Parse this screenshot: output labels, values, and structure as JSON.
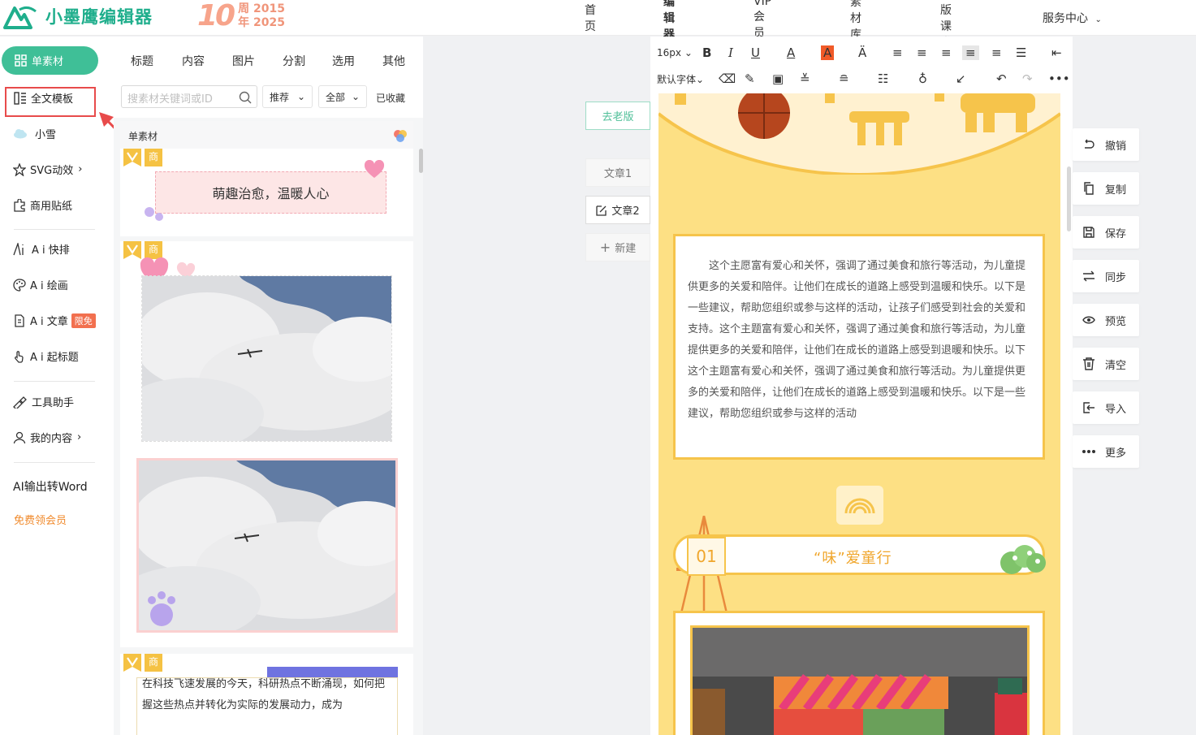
{
  "header": {
    "logo_text": "小墨鹰编辑器",
    "anniversary": {
      "number": "10",
      "line1": "周 2015",
      "line2": "年 2025"
    },
    "nav": [
      "首页",
      "编辑器",
      "VIP会员",
      "素材库",
      "排版课堂",
      "服务中心"
    ]
  },
  "sidebar": {
    "active": "单素材",
    "items": [
      "全文模板",
      "小雪",
      "SVG动效",
      "商用贴纸",
      "A i 快排",
      "A i 绘画",
      "A i 文章",
      "A i 起标题",
      "工具助手",
      "我的内容",
      "AI输出转Word"
    ],
    "badge_limited": "限免",
    "free_vip": "免费领会员"
  },
  "panel": {
    "tabs": [
      "标题",
      "内容",
      "图片",
      "分割",
      "选用",
      "其他"
    ],
    "search_placeholder": "搜素材关键词或ID",
    "filter_recommend": "推荐",
    "filter_all": "全部",
    "favorites": "已收藏",
    "section_title": "单素材",
    "tag_shang": "商",
    "card1_text": "萌趣治愈，温暖人心",
    "card3_text": "在科技飞速发展的今天，科研热点不断涌现，如何把握这些热点并转化为实际的发展动力，成为"
  },
  "middle": {
    "old_version": "去老版",
    "article1": "文章1",
    "article2": "文章2",
    "new": "新建"
  },
  "editor": {
    "font_size": "16px",
    "default_font": "默认字体",
    "body_text": "这个主愿富有爱心和关怀，强调了通过美食和旅行等活动，为儿童提供更多的关爱和陪伴。让他们在成长的道路上感受到温暖和快乐。以下是一些建议，帮助您组织或参与这样的活动，让孩子们感受到社会的关爱和支持。这个主题富有爱心和关怀，强调了通过美食和旅行等活动，为儿童提供更多的关爱和陪伴，让他们在成长的道路上感受到退暖和快乐。以下这个主题富有爱心和关怀，强调了通过美食和旅行等活动。为儿童提供更多的关爱和陪伴，让他们在成长的道路上感受到温暖和快乐。以下是一些建议，帮助您组织或参与这样的活动",
    "section_num": "01",
    "section_title": "“味”爱童行"
  },
  "actions": [
    "撤销",
    "复制",
    "保存",
    "同步",
    "预览",
    "清空",
    "导入",
    "更多"
  ],
  "colors": {
    "brand": "#3fbf97",
    "doc_bg": "#fde084",
    "doc_border": "#f6c44b",
    "accent": "#f0a62c"
  }
}
